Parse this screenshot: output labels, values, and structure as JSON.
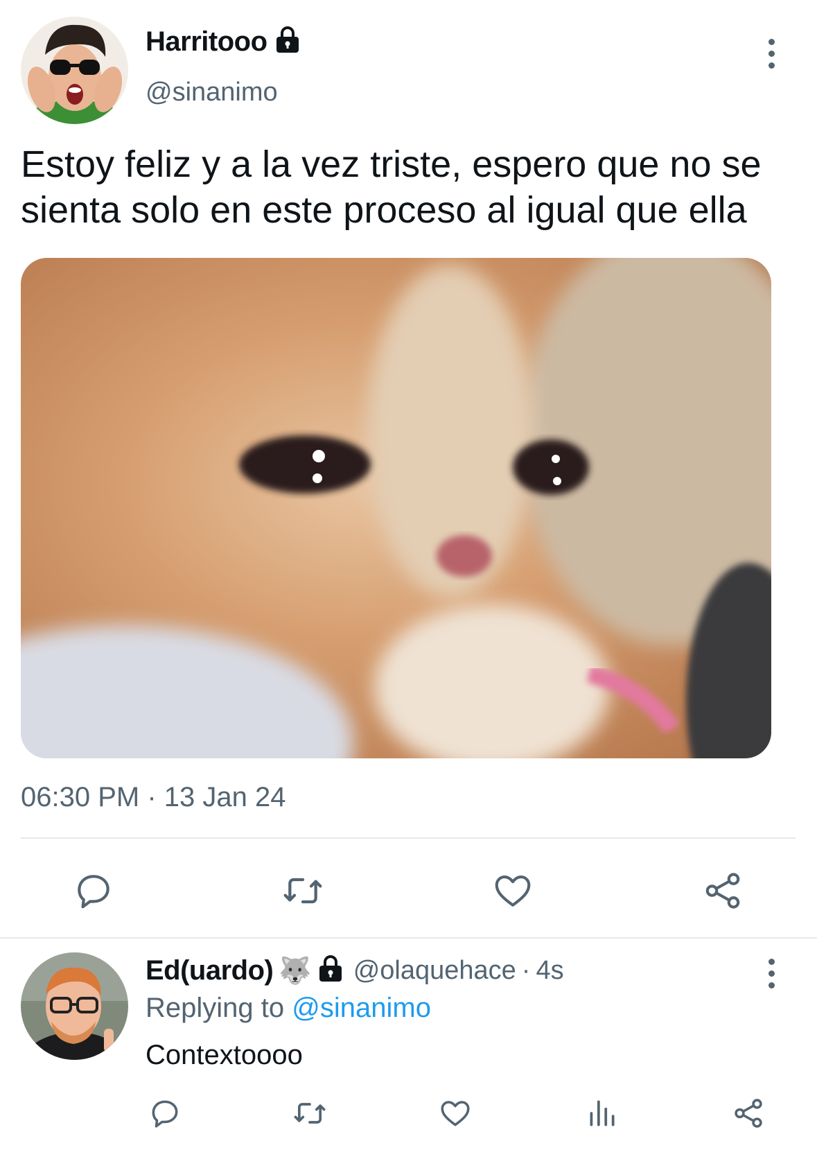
{
  "main_tweet": {
    "author_name": "Harritooo",
    "author_handle": "@sinanimo",
    "text": "Estoy feliz y a la vez triste, espero que no se sienta solo en este proceso al igual que ella",
    "time": "06:30 PM",
    "separator": "·",
    "date": "13 Jan 24",
    "icons": [
      "lock-icon",
      "more-options-icon",
      "reply-icon",
      "retweet-icon",
      "like-icon",
      "share-icon"
    ]
  },
  "reply": {
    "author_name": "Ed(uardo)",
    "author_emoji": "🐺",
    "author_handle": "@olaquehace",
    "separator": "·",
    "age": "4s",
    "replying_label": "Replying to",
    "replying_to": "@sinanimo",
    "text": "Contextoooo",
    "icons": [
      "lock-icon",
      "more-options-icon",
      "reply-icon",
      "retweet-icon",
      "like-icon",
      "views-icon",
      "share-icon"
    ]
  },
  "colors": {
    "text": "#0f1419",
    "secondary": "#536471",
    "link": "#1d9bf0",
    "divider": "#e6e9ec"
  }
}
